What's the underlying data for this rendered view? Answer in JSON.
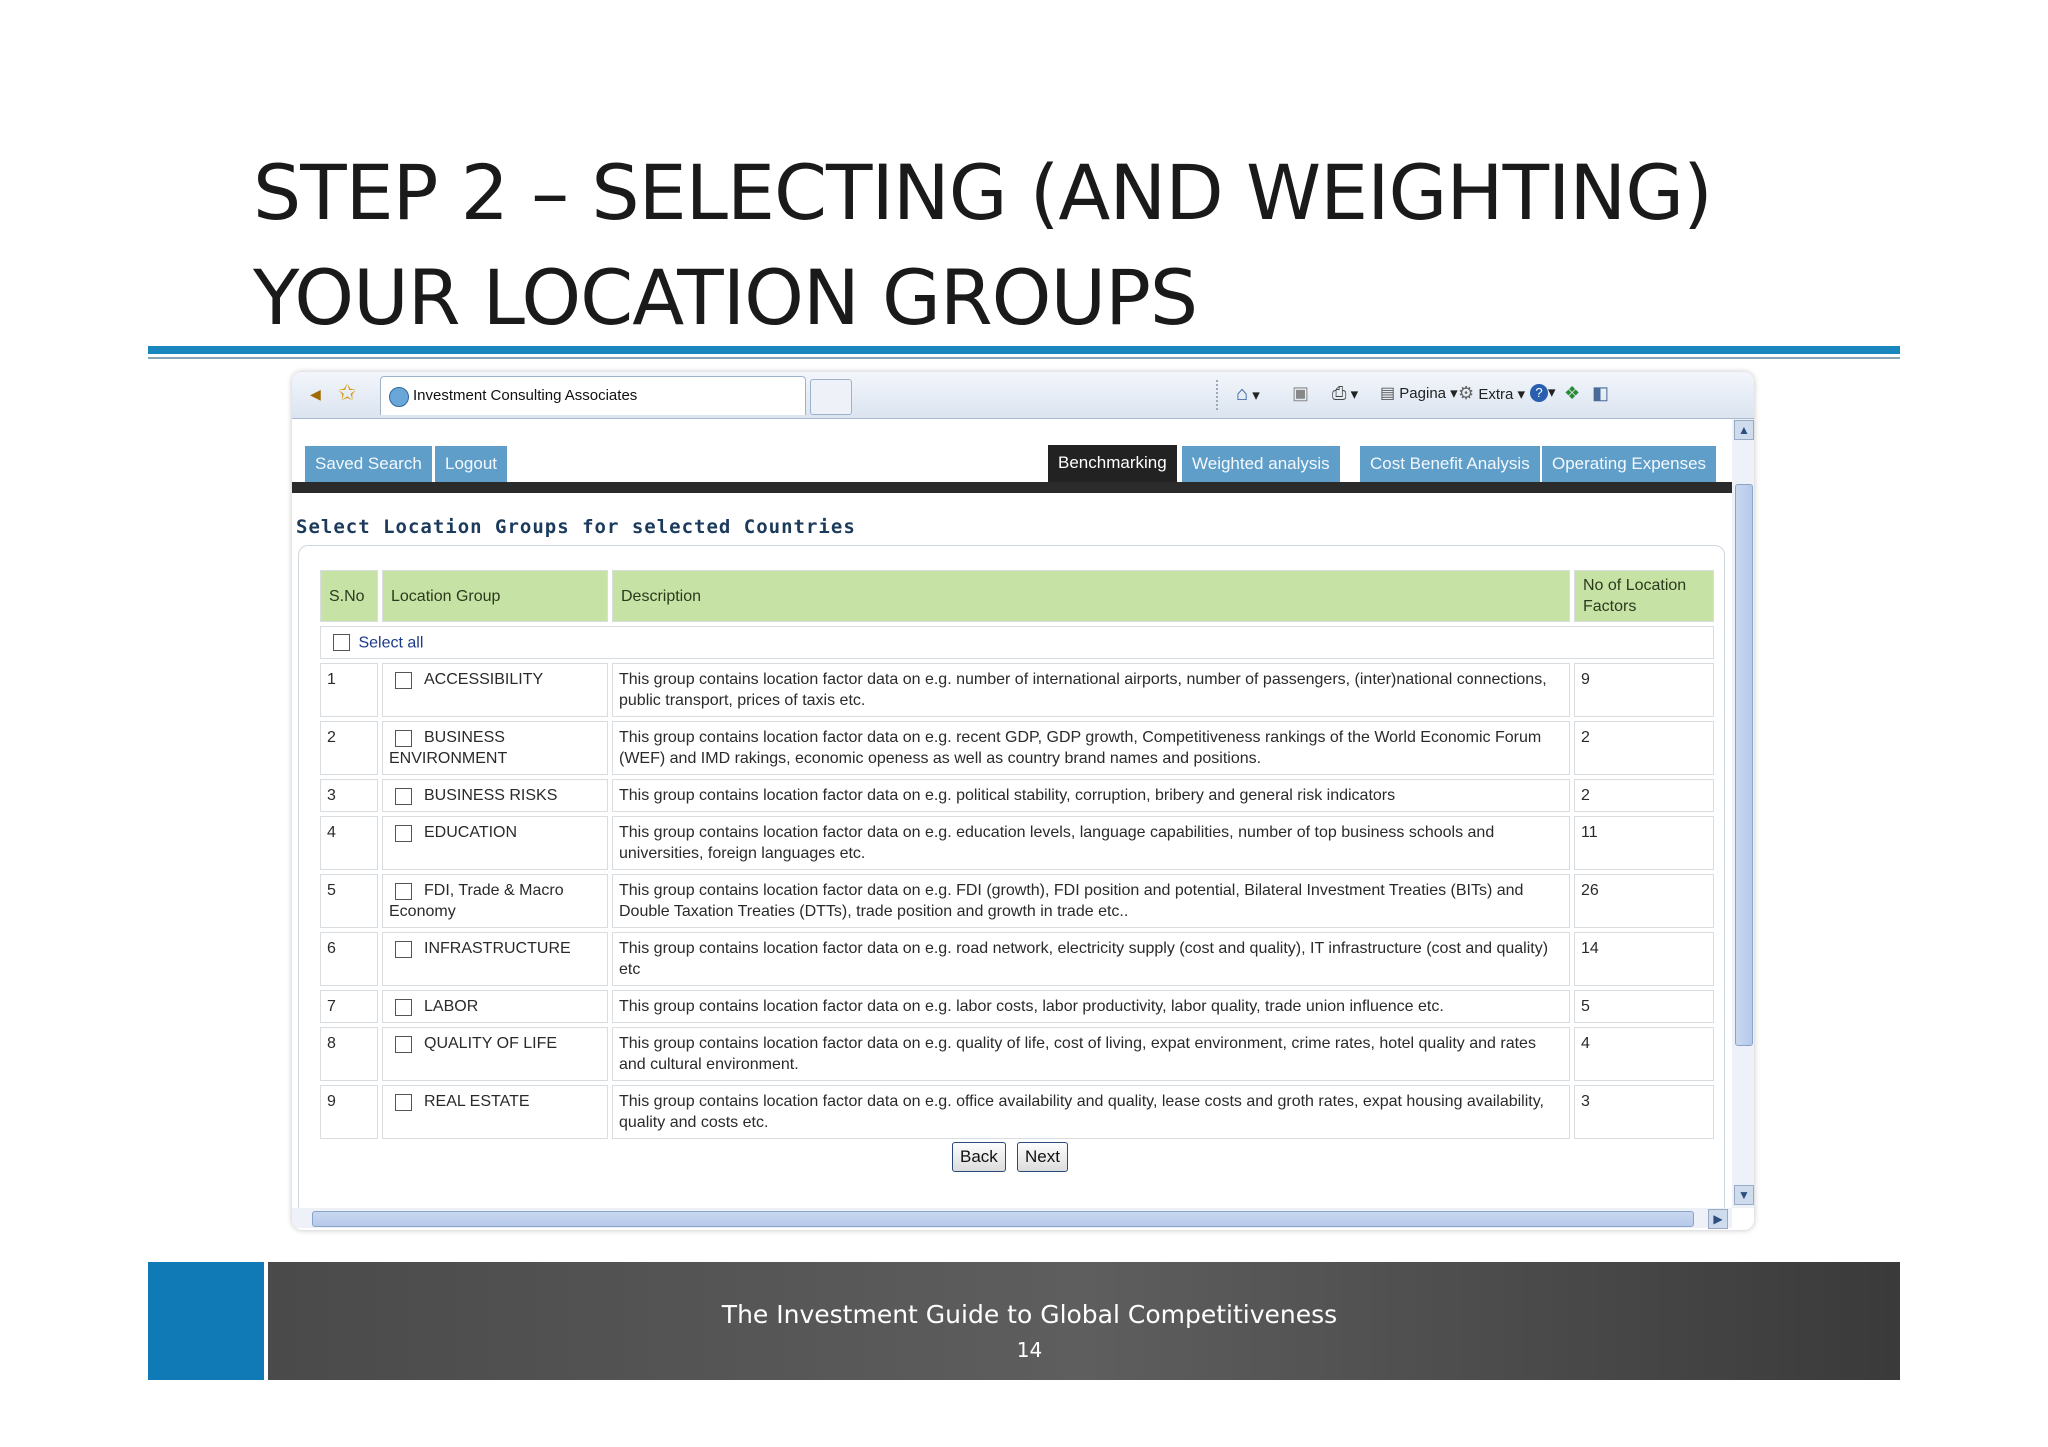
{
  "slide": {
    "title_line1": "STEP 2 – SELECTING (AND WEIGHTING)",
    "title_line2": "YOUR LOCATION GROUPS",
    "footer_text": "The Investment Guide to Global Competitiveness",
    "page_number": "14"
  },
  "browser": {
    "tab_title": "Investment Consulting Associates",
    "toolbar": {
      "page_label": "Pagina",
      "extra_label": "Extra"
    }
  },
  "nav": {
    "left": [
      "Saved Search",
      "Logout"
    ],
    "right": [
      "Benchmarking",
      "Weighted analysis",
      "Cost Benefit Analysis",
      "Operating Expenses"
    ],
    "active": "Benchmarking"
  },
  "section_heading": "Select Location Groups for selected Countries",
  "table": {
    "headers": [
      "S.No",
      "Location Group",
      "Description",
      "No of Location Factors"
    ],
    "select_all_label": "Select all",
    "rows": [
      {
        "no": "1",
        "group": "ACCESSIBILITY",
        "description": "This group contains location factor data on e.g. number of international airports, number of passengers, (inter)national connections, public transport, prices of taxis etc.",
        "count": "9"
      },
      {
        "no": "2",
        "group": "BUSINESS ENVIRONMENT",
        "description": "This group contains location factor data on e.g. recent GDP, GDP growth, Competitiveness rankings of the World Economic Forum (WEF) and IMD rakings, economic openess as well as country brand names and positions.",
        "count": "2"
      },
      {
        "no": "3",
        "group": "BUSINESS RISKS",
        "description": "This group contains location factor data on e.g. political stability, corruption, bribery and general risk indicators",
        "count": "2"
      },
      {
        "no": "4",
        "group": "EDUCATION",
        "description": "This group contains location factor data on e.g. education levels, language capabilities, number of top business schools and universities, foreign languages etc.",
        "count": "11"
      },
      {
        "no": "5",
        "group": "FDI, Trade & Macro Economy",
        "description": "This group contains location factor data on e.g. FDI (growth), FDI position and potential, Bilateral Investment Treaties (BITs) and Double Taxation Treaties (DTTs), trade position and growth in trade etc..",
        "count": "26"
      },
      {
        "no": "6",
        "group": "INFRASTRUCTURE",
        "description": "This group contains location factor data on e.g. road network, electricity supply (cost and quality), IT infrastructure (cost and quality) etc",
        "count": "14"
      },
      {
        "no": "7",
        "group": "LABOR",
        "description": "This group contains location factor data on e.g. labor costs, labor productivity, labor quality, trade union influence etc.",
        "count": "5"
      },
      {
        "no": "8",
        "group": "QUALITY OF LIFE",
        "description": "This group contains location factor data on e.g. quality of life, cost of living, expat environment, crime rates, hotel quality and rates and cultural environment.",
        "count": "4"
      },
      {
        "no": "9",
        "group": "REAL ESTATE",
        "description": "This group contains location factor data on e.g. office availability and quality, lease costs and groth rates, expat housing availability, quality and costs etc.",
        "count": "3"
      }
    ]
  },
  "buttons": {
    "back": "Back",
    "next": "Next"
  }
}
